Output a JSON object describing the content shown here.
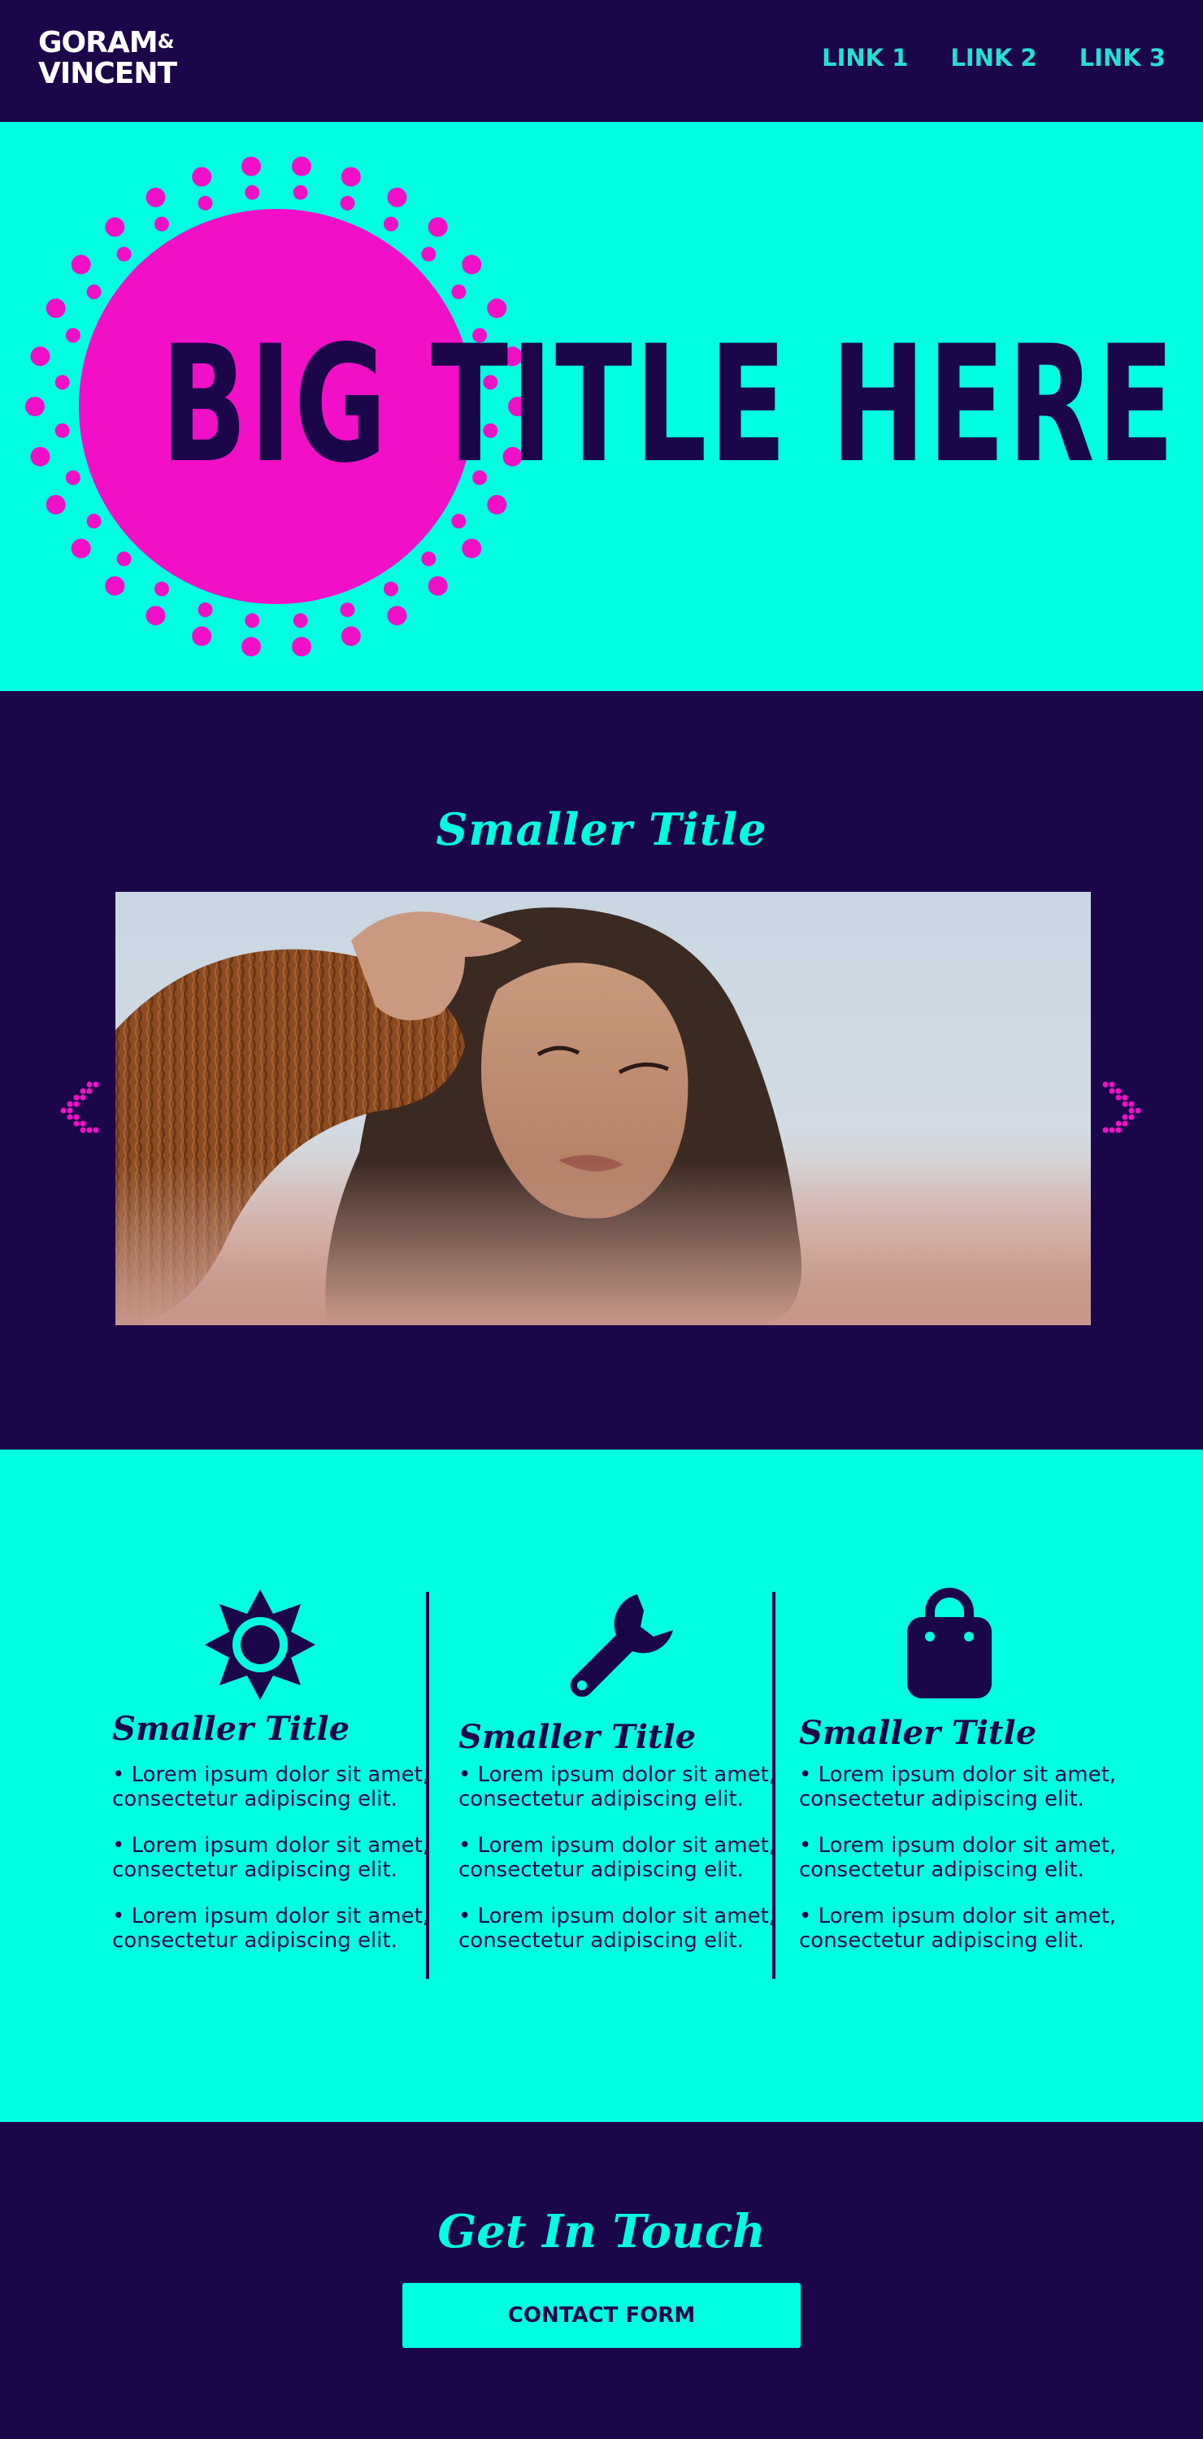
{
  "header": {
    "logo_line1": "GORAM",
    "logo_amp": "&",
    "logo_line2": "VINCENT",
    "nav": [
      "LINK 1",
      "LINK 2",
      "LINK 3"
    ]
  },
  "hero": {
    "title": "BIG TITLE HERE"
  },
  "gallery": {
    "title": "Smaller Title"
  },
  "features": [
    {
      "icon": "gear-sun-icon",
      "title": "Smaller Title",
      "bullets": [
        "• Lorem ipsum dolor sit amet, consectetur adipiscing elit.",
        "• Lorem ipsum dolor sit amet, consectetur adipiscing elit.",
        "• Lorem ipsum dolor sit amet, consectetur adipiscing elit."
      ]
    },
    {
      "icon": "wrench-icon",
      "title": "Smaller Title",
      "bullets": [
        "• Lorem ipsum dolor sit amet, consectetur adipiscing elit.",
        "• Lorem ipsum dolor sit amet, consectetur adipiscing elit.",
        "• Lorem ipsum dolor sit amet, consectetur adipiscing elit."
      ]
    },
    {
      "icon": "shopping-bag-icon",
      "title": "Smaller Title",
      "bullets": [
        "• Lorem ipsum dolor sit amet, consectetur adipiscing elit.",
        "• Lorem ipsum dolor sit amet, consectetur adipiscing elit.",
        "• Lorem ipsum dolor sit amet, consectetur adipiscing elit."
      ]
    }
  ],
  "contact": {
    "title": "Get In Touch",
    "button_label": "CONTACT FORM"
  },
  "colors": {
    "navy": "#1b064a",
    "aqua": "#00ffe0",
    "magenta": "#f20fc8",
    "link": "#25e0d2"
  }
}
